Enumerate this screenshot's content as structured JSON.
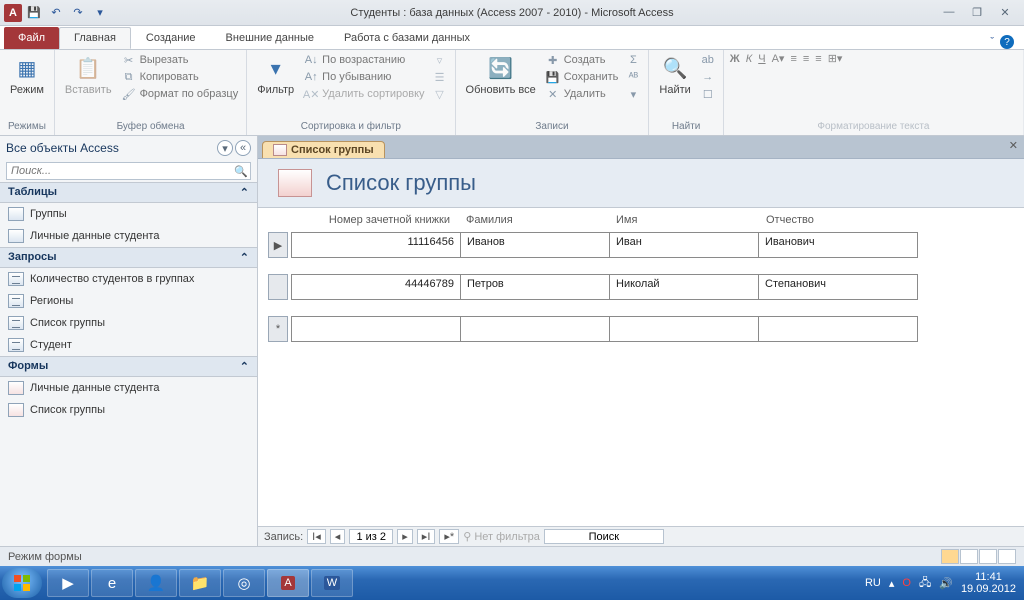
{
  "title": "Студенты : база данных (Access 2007 - 2010)  -  Microsoft Access",
  "tabs": {
    "file": "Файл",
    "home": "Главная",
    "create": "Создание",
    "external": "Внешние данные",
    "dbtools": "Работа с базами данных"
  },
  "ribbon": {
    "views": {
      "mode": "Режим",
      "label": "Режимы"
    },
    "clipboard": {
      "paste": "Вставить",
      "cut": "Вырезать",
      "copy": "Копировать",
      "format": "Формат по образцу",
      "label": "Буфер обмена"
    },
    "sort": {
      "filter": "Фильтр",
      "asc": "По возрастанию",
      "desc": "По убыванию",
      "clear": "Удалить сортировку",
      "label": "Сортировка и фильтр"
    },
    "records": {
      "refresh": "Обновить все",
      "new": "Создать",
      "save": "Сохранить",
      "delete": "Удалить",
      "label": "Записи"
    },
    "find": {
      "find": "Найти",
      "label": "Найти"
    },
    "textfmt": {
      "label": "Форматирование текста"
    }
  },
  "nav": {
    "header": "Все объекты Access",
    "search_placeholder": "Поиск...",
    "groups": {
      "tables": {
        "label": "Таблицы",
        "items": [
          "Группы",
          "Личные данные студента"
        ]
      },
      "queries": {
        "label": "Запросы",
        "items": [
          "Количество студентов в группах",
          "Регионы",
          "Список группы",
          "Студент"
        ]
      },
      "forms": {
        "label": "Формы",
        "items": [
          "Личные данные студента",
          "Список группы"
        ]
      }
    }
  },
  "form": {
    "tab": "Список группы",
    "title": "Список группы",
    "columns": [
      "Номер зачетной книжки",
      "Фамилия",
      "Имя",
      "Отчество"
    ],
    "rows": [
      {
        "sel": "▶",
        "c": [
          "11116456",
          "Иванов",
          "Иван",
          "Иванович"
        ]
      },
      {
        "sel": "",
        "c": [
          "44446789",
          "Петров",
          "Николай",
          "Степанович"
        ]
      },
      {
        "sel": "*",
        "c": [
          "",
          "",
          "",
          ""
        ]
      }
    ],
    "nav": {
      "label": "Запись:",
      "pos": "1 из 2",
      "nofilter": "Нет фильтра",
      "search": "Поиск"
    }
  },
  "status": {
    "mode": "Режим формы"
  },
  "tray": {
    "lang": "RU",
    "time": "11:41",
    "date": "19.09.2012"
  }
}
